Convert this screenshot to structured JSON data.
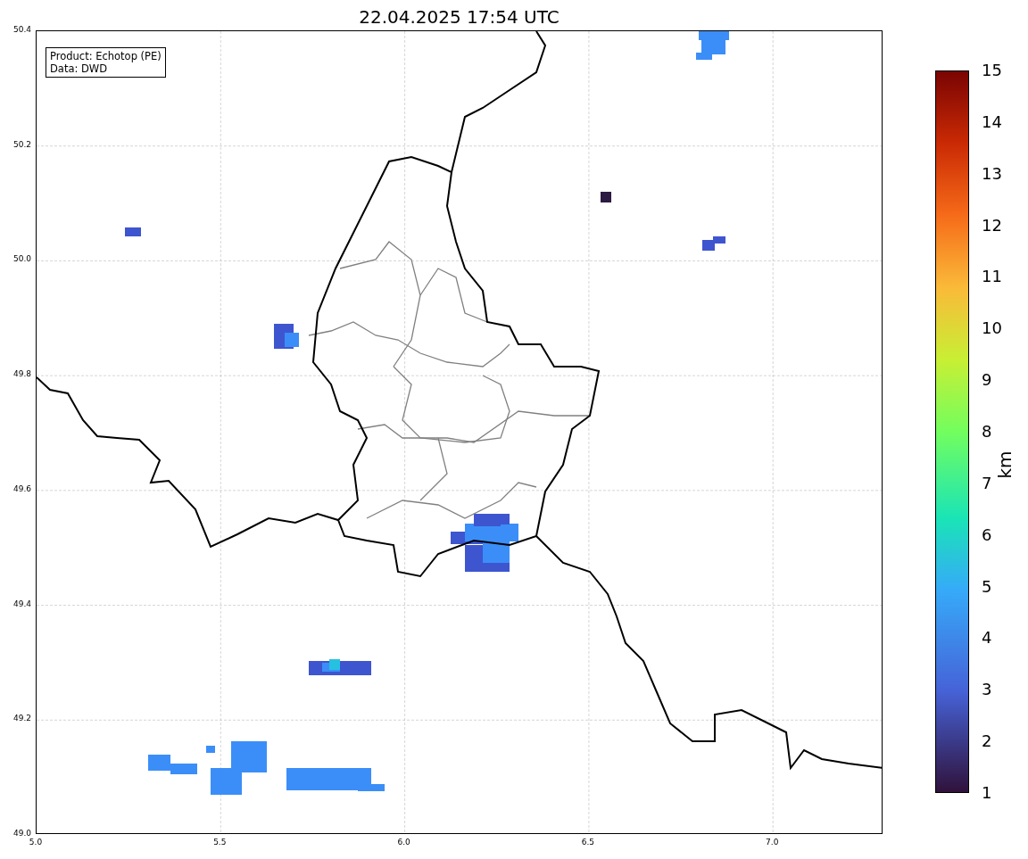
{
  "title": "22.04.2025 17:54 UTC",
  "info_box": [
    "Product: Echotop (PE)",
    "Data: DWD"
  ],
  "axes": {
    "xticks": [
      "5.0",
      "5.5",
      "6.0",
      "6.5",
      "7.0"
    ],
    "yticks": [
      "50.4",
      "50.2",
      "50.0",
      "49.8",
      "49.6",
      "49.4",
      "49.2",
      "49.0"
    ]
  },
  "colorbar": {
    "label": "km",
    "ticks": [
      "15",
      "14",
      "13",
      "12",
      "11",
      "10",
      "9",
      "8",
      "7",
      "6",
      "5",
      "4",
      "3",
      "2",
      "1"
    ]
  }
}
